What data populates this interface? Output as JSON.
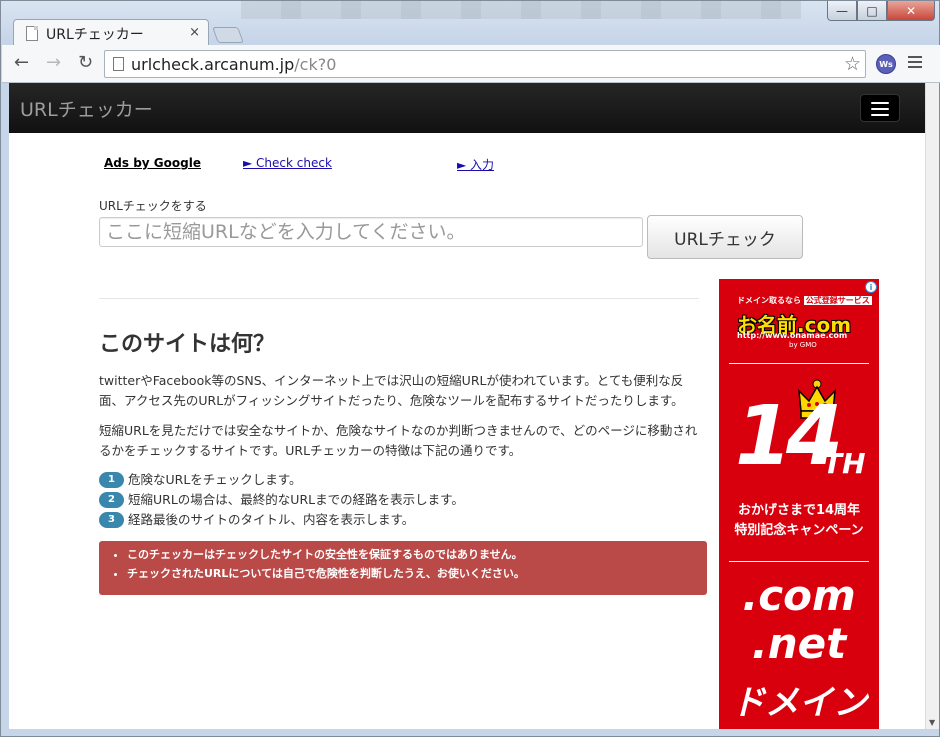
{
  "browser": {
    "tab_title": "URLチェッカー",
    "tab_close": "×",
    "url_host": "urlcheck.arcanum.jp",
    "url_path": "/ck?0",
    "window_buttons": {
      "minimize": "—",
      "maximize": "□",
      "close": "✕"
    },
    "ext_label": "Ws"
  },
  "site": {
    "brand": "URLチェッカー",
    "ads": {
      "by_google": "Ads by Google",
      "link1": "► Check check",
      "link2": "► 入力"
    },
    "form": {
      "label": "URLチェックをする",
      "placeholder": "ここに短縮URLなどを入力してください。",
      "button": "URLチェック"
    },
    "about": {
      "title": "このサイトは何？",
      "para1": "twitterやFacebook等のSNS、インターネット上では沢山の短縮URLが使われています。とても便利な反面、アクセス先のURLがフィッシングサイトだったり、危険なツールを配布するサイトだったりします。",
      "para2": "短縮URLを見ただけでは安全なサイトか、危険なサイトなのか判断つきませんので、どのページに移動されるかをチェックするサイトです。URLチェッカーの特徴は下記の通りです。",
      "steps": [
        {
          "num": "1",
          "text": "危険なURLをチェックします。"
        },
        {
          "num": "2",
          "text": "短縮URLの場合は、最終的なURLまでの経路を表示します。"
        },
        {
          "num": "3",
          "text": "経路最後のサイトのタイトル、内容を表示します。"
        }
      ],
      "warnings": [
        "このチェッカーはチェックしたサイトの安全性を保証するものではありません。",
        "チェックされたURLについては自己で危険性を判断したうえ、お使いください。"
      ]
    },
    "banner": {
      "top_text": "ドメイン取るなら",
      "badge": "公式登録サービス",
      "logo": "お名前.com",
      "url": "http://www.onamae.com",
      "gmo": "by GMO",
      "big": "14",
      "th": "TH",
      "cap1": "おかげさまで14周年",
      "cap2": "特別記念キャンペーン",
      "com": ".com",
      "net": ".net",
      "domain": "ドメイン",
      "info": "i",
      "color": "#d9000d"
    }
  }
}
